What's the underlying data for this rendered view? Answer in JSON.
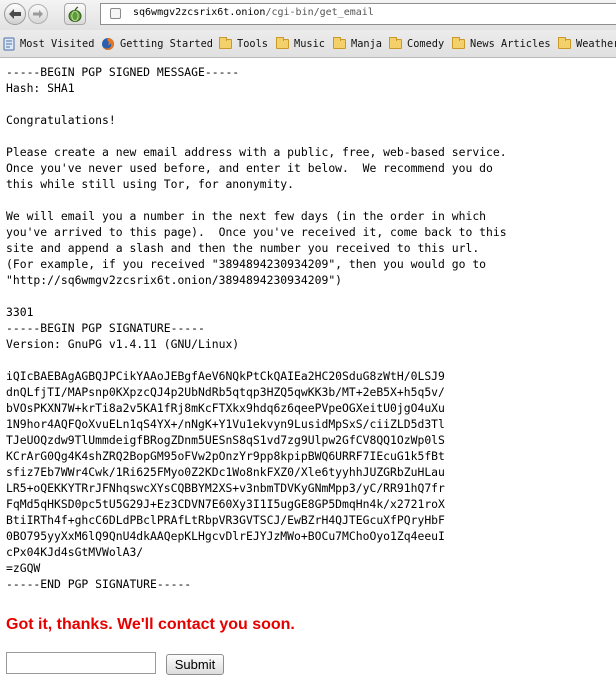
{
  "toolbar": {
    "back_icon": "arrow-left-icon",
    "forward_icon": "arrow-right-icon",
    "home_icon": "onion-icon",
    "url_domain": "sq6wmgv2zcsrix6t.onion",
    "url_path": "/cgi-bin/get_email"
  },
  "bookmarks": [
    {
      "label": "Most Visited",
      "icon": "most-visited-icon"
    },
    {
      "label": "Getting Started",
      "icon": "firefox-icon"
    },
    {
      "label": "Tools",
      "icon": "folder-icon"
    },
    {
      "label": "Music",
      "icon": "folder-icon"
    },
    {
      "label": "Manja",
      "icon": "folder-icon"
    },
    {
      "label": "Comedy",
      "icon": "folder-icon"
    },
    {
      "label": "News Articles",
      "icon": "folder-icon"
    },
    {
      "label": "Weather",
      "icon": "folder-icon"
    }
  ],
  "page": {
    "message": "-----BEGIN PGP SIGNED MESSAGE-----\nHash: SHA1\n\nCongratulations!\n\nPlease create a new email address with a public, free, web-based service.\nOnce you've never used before, and enter it below.  We recommend you do\nthis while still using Tor, for anonymity.\n\nWe will email you a number in the next few days (in the order in which\nyou've arrived to this page).  Once you've received it, come back to this\nsite and append a slash and then the number you received to this url.\n(For example, if you received \"3894894230934209\", then you would go to\n\"http://sq6wmgv2zcsrix6t.onion/3894894230934209\")\n\n3301\n-----BEGIN PGP SIGNATURE-----\nVersion: GnuPG v1.4.11 (GNU/Linux)\n\niQIcBAEBAgAGBQJPCikYAAoJEBgfAeV6NQkPtCkQAIEa2HC20SduG8zWtH/0LSJ9\ndnQLfjTI/MAPsnp0KXpzcQJ4p2UbNdRb5qtqp3HZQ5qwKK3b/MT+2eB5X+h5q5v/\nbVOsPKXN7W+krTi8a2v5KA1fRj8mKcFTXkx9hdq6z6qeePVpeOGXeitU0jgO4uXu\n1N9hor4AQFQoXvuELn1qS4YX+/nNgK+Y1Vu1ekvyn9LusidMpSxS/ciiZLD5d3Tl\nTJeUOQzdw9TlUmmdeigfBRogZDnm5UESnS8qS1vd7zg9Ulpw2GfCV8QQ1OzWp0lS\nKCrArG0Qg4K4shZRQ2BopGM95oFVw2pOnzYr9pp8kpipBWQ6URRF7IEcuG1k5fBt\nsfiz7Eb7WWr4Cwk/1Ri625FMyo0Z2KDc1Wo8nkFXZ0/Xle6tyyhhJUZGRbZuHLau\nLR5+oQEKKYTRrJFNhqswcXYsCQBBYM2XS+v3nbmTDVKyGNmMpp3/yC/RR91hQ7fr\nFqMd5qHKSD0pc5tU5G29J+Ez3CDVN7E60Xy3I1I5ugGE8GP5DmqHn4k/x2721roX\nBtiIRTh4f+ghcC6DLdPBclPRAfLtRbpVR3GVTSCJ/EwBZrH4QJTEGcuXfPQryHbF\n0BO795yyXxM6lQ9QnU4dkAAQepKLHgcvDlrEJYJzMWo+BOCu7MChoOyo1Zq4eeuI\ncPx04KJd4sGtMVWolA3/\n=zGQW\n-----END PGP SIGNATURE-----",
    "confirmation": "Got it, thanks. We'll contact you soon.",
    "email_value": "",
    "submit_label": "Submit"
  },
  "colors": {
    "confirmation": "#e60000",
    "folder": "#f4d06a"
  }
}
